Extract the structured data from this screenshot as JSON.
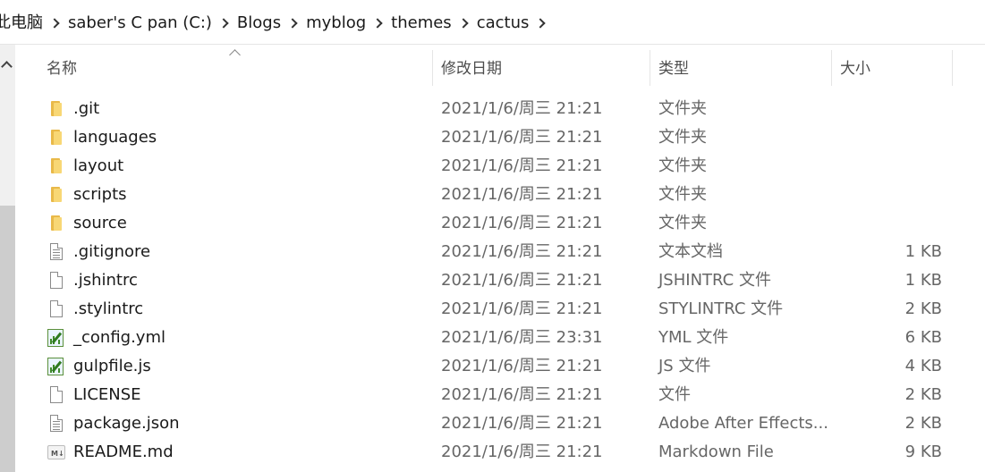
{
  "breadcrumb": [
    "此电脑",
    "saber's C pan (C:)",
    "Blogs",
    "myblog",
    "themes",
    "cactus"
  ],
  "columns": {
    "name": "名称",
    "date": "修改日期",
    "type": "类型",
    "size": "大小"
  },
  "files": [
    {
      "name": ".git",
      "date": "2021/1/6/周三 21:21",
      "type": "文件夹",
      "size": "",
      "icon": "folder-icon"
    },
    {
      "name": "languages",
      "date": "2021/1/6/周三 21:21",
      "type": "文件夹",
      "size": "",
      "icon": "folder-icon"
    },
    {
      "name": "layout",
      "date": "2021/1/6/周三 21:21",
      "type": "文件夹",
      "size": "",
      "icon": "folder-icon"
    },
    {
      "name": "scripts",
      "date": "2021/1/6/周三 21:21",
      "type": "文件夹",
      "size": "",
      "icon": "folder-icon"
    },
    {
      "name": "source",
      "date": "2021/1/6/周三 21:21",
      "type": "文件夹",
      "size": "",
      "icon": "folder-icon"
    },
    {
      "name": ".gitignore",
      "date": "2021/1/6/周三 21:21",
      "type": "文本文档",
      "size": "1 KB",
      "icon": "text-file-icon"
    },
    {
      "name": ".jshintrc",
      "date": "2021/1/6/周三 21:21",
      "type": "JSHINTRC 文件",
      "size": "1 KB",
      "icon": "file-icon"
    },
    {
      "name": ".stylintrc",
      "date": "2021/1/6/周三 21:21",
      "type": "STYLINTRC 文件",
      "size": "2 KB",
      "icon": "file-icon"
    },
    {
      "name": "_config.yml",
      "date": "2021/1/6/周三 23:31",
      "type": "YML 文件",
      "size": "6 KB",
      "icon": "editor-file-icon"
    },
    {
      "name": "gulpfile.js",
      "date": "2021/1/6/周三 21:21",
      "type": "JS 文件",
      "size": "4 KB",
      "icon": "editor-file-icon"
    },
    {
      "name": "LICENSE",
      "date": "2021/1/6/周三 21:21",
      "type": "文件",
      "size": "2 KB",
      "icon": "file-icon"
    },
    {
      "name": "package.json",
      "date": "2021/1/6/周三 21:21",
      "type": "Adobe After Effects...",
      "size": "2 KB",
      "icon": "text-file-icon"
    },
    {
      "name": "README.md",
      "date": "2021/1/6/周三 21:21",
      "type": "Markdown File",
      "size": "9 KB",
      "icon": "markdown-file-icon"
    }
  ]
}
